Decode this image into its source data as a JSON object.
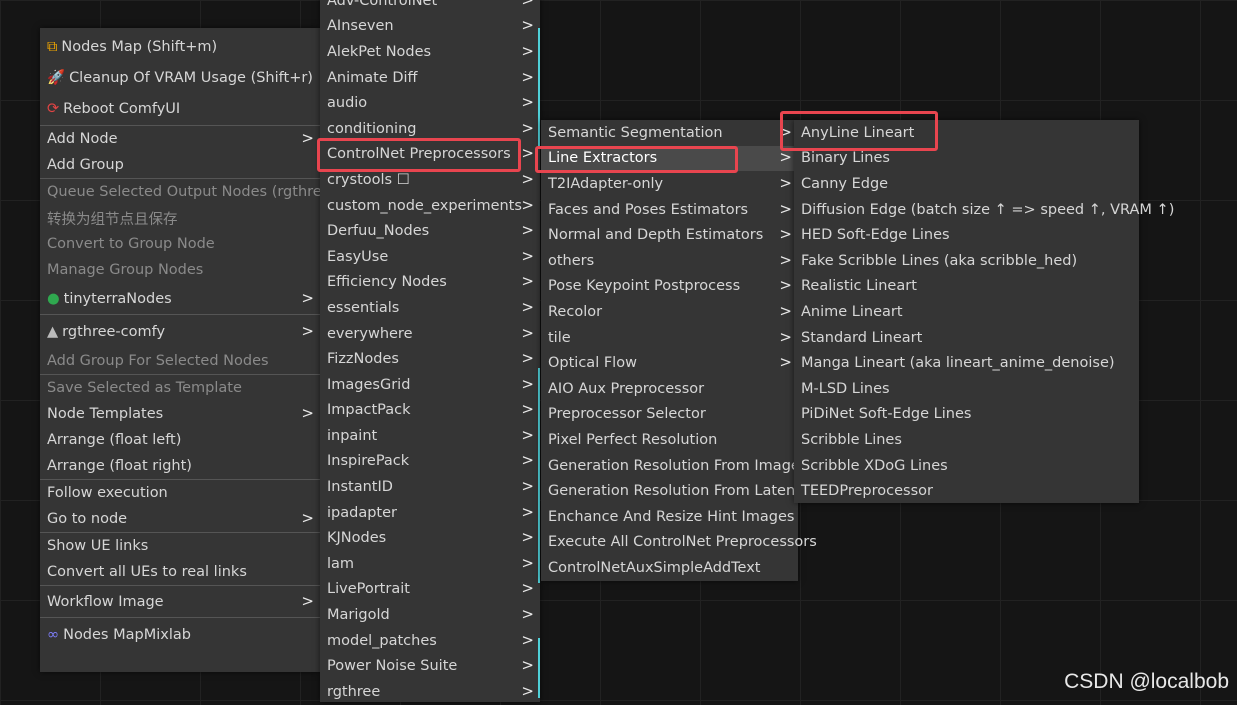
{
  "main_menu": {
    "items": [
      {
        "label": "Nodes Map (Shift+m)",
        "icon": "sitemap-icon",
        "disabled": false,
        "submenu": false
      },
      {
        "label": "Cleanup Of VRAM Usage (Shift+r)",
        "icon": "rocket-icon",
        "disabled": false,
        "submenu": false
      },
      {
        "label": "Reboot ComfyUI",
        "icon": "reboot-icon",
        "disabled": false,
        "submenu": false
      },
      {
        "label": "Add Node",
        "disabled": false,
        "submenu": true
      },
      {
        "label": "Add Group",
        "disabled": false,
        "submenu": false
      },
      {
        "label": "Queue Selected Output Nodes (rgthree)",
        "disabled": true,
        "submenu": false
      },
      {
        "label": "转换为组节点且保存",
        "disabled": true,
        "submenu": false
      },
      {
        "label": "Convert to Group Node",
        "disabled": true,
        "submenu": false
      },
      {
        "label": "Manage Group Nodes",
        "disabled": true,
        "submenu": false
      },
      {
        "label": "tinyterraNodes",
        "icon": "globe-icon",
        "disabled": false,
        "submenu": true
      },
      {
        "label": "rgthree-comfy",
        "icon": "pyramid-icon",
        "disabled": false,
        "submenu": true
      },
      {
        "label": "Add Group For Selected Nodes",
        "disabled": true,
        "submenu": false
      },
      {
        "label": "Save Selected as Template",
        "disabled": true,
        "submenu": false
      },
      {
        "label": "Node Templates",
        "disabled": false,
        "submenu": true
      },
      {
        "label": "Arrange (float left)",
        "disabled": false,
        "submenu": false
      },
      {
        "label": "Arrange (float right)",
        "disabled": false,
        "submenu": false
      },
      {
        "label": "Follow execution",
        "disabled": false,
        "submenu": false
      },
      {
        "label": "Go to node",
        "disabled": false,
        "submenu": true
      },
      {
        "label": "Show UE links",
        "disabled": false,
        "submenu": false
      },
      {
        "label": "Convert all UEs to real links",
        "disabled": false,
        "submenu": false
      },
      {
        "label": "Workflow Image",
        "disabled": false,
        "submenu": true
      },
      {
        "label": "Nodes Map",
        "suffix": "Mixlab",
        "icon": "infinity-icon",
        "disabled": false,
        "submenu": false
      }
    ]
  },
  "categories_menu": {
    "items": [
      "Adv-ControlNet",
      "AInseven",
      "AlekPet Nodes",
      "Animate Diff",
      "audio",
      "conditioning",
      "ControlNet Preprocessors",
      "crystools ☐",
      "custom_node_experiments",
      "Derfuu_Nodes",
      "EasyUse",
      "Efficiency Nodes",
      "essentials",
      "everywhere",
      "FizzNodes",
      "ImagesGrid",
      "ImpactPack",
      "inpaint",
      "InspirePack",
      "InstantID",
      "ipadapter",
      "KJNodes",
      "lam",
      "LivePortrait",
      "Marigold",
      "model_patches",
      "Power Noise Suite",
      "rgthree"
    ],
    "highlighted": "ControlNet Preprocessors"
  },
  "preprocessors_menu": {
    "items": [
      {
        "label": "Semantic Segmentation",
        "submenu": true
      },
      {
        "label": "Line Extractors",
        "submenu": true
      },
      {
        "label": "T2IAdapter-only",
        "submenu": true
      },
      {
        "label": "Faces and Poses Estimators",
        "submenu": true
      },
      {
        "label": "Normal and Depth Estimators",
        "submenu": true
      },
      {
        "label": "others",
        "submenu": true
      },
      {
        "label": "Pose Keypoint Postprocess",
        "submenu": true
      },
      {
        "label": "Recolor",
        "submenu": true
      },
      {
        "label": "tile",
        "submenu": true
      },
      {
        "label": "Optical Flow",
        "submenu": true
      },
      {
        "label": "AIO Aux Preprocessor",
        "submenu": false
      },
      {
        "label": "Preprocessor Selector",
        "submenu": false
      },
      {
        "label": "Pixel Perfect Resolution",
        "submenu": false
      },
      {
        "label": "Generation Resolution From Image",
        "submenu": false
      },
      {
        "label": "Generation Resolution From Latent",
        "submenu": false
      },
      {
        "label": "Enchance And Resize Hint Images",
        "submenu": false
      },
      {
        "label": "Execute All ControlNet Preprocessors",
        "submenu": false
      },
      {
        "label": "ControlNetAuxSimpleAddText",
        "submenu": false
      }
    ],
    "highlighted": "Line Extractors"
  },
  "line_extractors_menu": {
    "items": [
      "AnyLine Lineart",
      "Binary Lines",
      "Canny Edge",
      "Diffusion Edge (batch size ↑ => speed ↑, VRAM ↑)",
      "HED Soft-Edge Lines",
      "Fake Scribble Lines (aka scribble_hed)",
      "Realistic Lineart",
      "Anime Lineart",
      "Standard Lineart",
      "Manga Lineart (aka lineart_anime_denoise)",
      "M-LSD Lines",
      "PiDiNet Soft-Edge Lines",
      "Scribble Lines",
      "Scribble XDoG Lines",
      "TEEDPreprocessor"
    ],
    "highlighted": "AnyLine Lineart"
  },
  "watermark": "CSDN @localbob",
  "colors": {
    "highlight_border": "#e8454f",
    "teal_accent": "#4fd0d8",
    "menu_bg": "#353535"
  }
}
